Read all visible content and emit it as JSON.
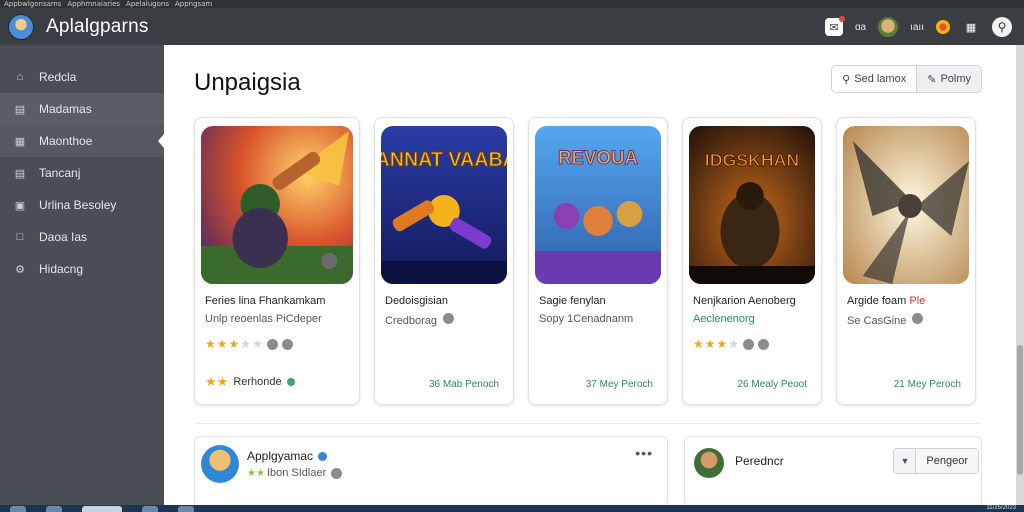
{
  "window": {
    "tabs": [
      "Appbwlgonsams",
      "Apphmnaiaries",
      "Apelalugons",
      "Appngsam"
    ],
    "clock": "11/25/2023"
  },
  "header": {
    "app_title": "Aplalgparns",
    "user_label": "ıaıı",
    "notif_label": "ɑa",
    "icons": [
      "bell-icon",
      "user-avatar",
      "status-dot-icon",
      "grid-icon",
      "search-icon"
    ]
  },
  "sidebar": {
    "items": [
      {
        "label": "Redcla",
        "icon": "home-icon"
      },
      {
        "label": "Madamas",
        "icon": "chart-icon"
      },
      {
        "label": "Maonthoe",
        "icon": "grid-icon"
      },
      {
        "label": "Tancanj",
        "icon": "list-icon"
      },
      {
        "label": "Urlina Besoley",
        "icon": "calendar-icon"
      },
      {
        "label": "Daoa Ias",
        "icon": "document-icon"
      },
      {
        "label": "Hidacng",
        "icon": "settings-icon"
      }
    ]
  },
  "main": {
    "page_title": "Unpaigsia",
    "actions": [
      {
        "label": "Sed lamox",
        "icon": "filter-icon"
      },
      {
        "label": "Polmy",
        "icon": "edit-icon"
      }
    ],
    "cards": [
      {
        "art_title": "",
        "title": "Feries lina Fhankamkam",
        "subtitle": "Unlp reoenlas PiCdeper",
        "subtitle_style": "plain",
        "rating_stars": 2.5,
        "footer_label": "Rerhonde",
        "price": "",
        "colors": {
          "bg": "#8a3f1a",
          "accent": "#f3a12c",
          "fig": "#3b6b2a"
        }
      },
      {
        "art_title": "SIANNAT VAABAK",
        "title": "Dedoisgisian",
        "subtitle": "Credborag",
        "subtitle_style": "plain",
        "rating_stars": 0,
        "footer_label": "",
        "price": "36 Mab Penoch",
        "colors": {
          "bg": "#1c2a7a",
          "accent": "#f5c21b",
          "fig": "#e07a21"
        }
      },
      {
        "art_title": "REVOUA",
        "title": "Sagie fenylan",
        "subtitle": "Sopy 1Cenadnanm",
        "subtitle_style": "plain",
        "rating_stars": 0,
        "footer_label": "",
        "price": "37 Mey Peroch",
        "colors": {
          "bg": "#2a77c9",
          "accent": "#f0b62a",
          "fig": "#8a3fb3"
        }
      },
      {
        "art_title": "IDGSKHAN",
        "title": "Nenjkarion Aenoberg",
        "subtitle": "Aeclenenorg",
        "subtitle_style": "green",
        "rating_stars": 2.5,
        "footer_label": "",
        "price": "26 Mealy Peoot",
        "colors": {
          "bg": "#2a1a10",
          "accent": "#f2a020",
          "fig": "#5a3a1c"
        }
      },
      {
        "art_title": "",
        "title": "Argide foam",
        "title_highlight": "Ple",
        "subtitle": "Se CasGine",
        "subtitle_style": "plain",
        "rating_stars": 0,
        "footer_label": "",
        "price": "21 Mey Peroch",
        "colors": {
          "bg": "#e8cfa0",
          "accent": "#fff4d6",
          "fig": "#3a3530"
        }
      }
    ],
    "bottom_left": {
      "name": "Applgyamac",
      "rating_text": "Ibon SIdlaer"
    },
    "bottom_right": {
      "name": "Peredncr",
      "button_label": "Pengeor"
    }
  }
}
